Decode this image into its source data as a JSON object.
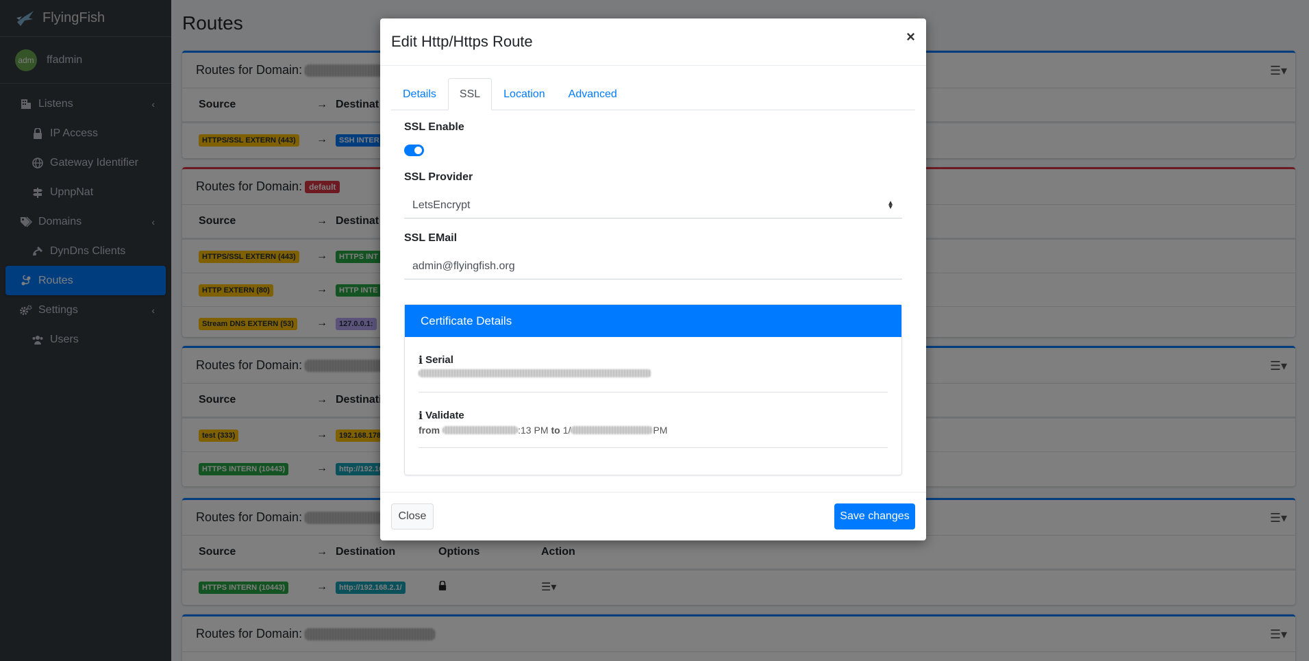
{
  "brand": {
    "name": "FlyingFish"
  },
  "user": {
    "avatar_text": "adm",
    "name": "ffadmin"
  },
  "sidebar": {
    "items": [
      {
        "label": "Listens",
        "icon": "building-icon",
        "has_children": true
      },
      {
        "label": "IP Access",
        "icon": "lock-icon",
        "sub": true
      },
      {
        "label": "Gateway Identifier",
        "icon": "globe-icon",
        "sub": true
      },
      {
        "label": "UpnpNat",
        "icon": "signpost-icon",
        "sub": true
      },
      {
        "label": "Domains",
        "icon": "tags-icon",
        "has_children": true
      },
      {
        "label": "DynDns Clients",
        "icon": "satellite-icon",
        "sub": true
      },
      {
        "label": "Routes",
        "icon": "route-icon",
        "active": true
      },
      {
        "label": "Settings",
        "icon": "cogs-icon",
        "has_children": true
      },
      {
        "label": "Users",
        "icon": "users-icon",
        "sub": true
      }
    ]
  },
  "page": {
    "title": "Routes"
  },
  "cards": {
    "header_prefix": "Routes for Domain:",
    "default_badge": "default",
    "col_source": "Source",
    "col_arrow": "→",
    "col_destination": "Destination",
    "col_destination_short": "Destinat",
    "col_options": "Options",
    "col_action": "Action",
    "card1": {
      "row1_src": "HTTPS/SSL EXTERN (443)",
      "row1_dst": "SSH INTER"
    },
    "card2": {
      "row1_src": "HTTPS/SSL EXTERN (443)",
      "row1_dst": "HTTPS INT",
      "row2_src": "HTTP EXTERN (80)",
      "row2_dst": "HTTP INTE",
      "row3_src": "Stream DNS EXTERN (53)",
      "row3_dst": "127.0.0.1:"
    },
    "card3": {
      "row1_src": "test (333)",
      "row1_dst": "192.168.178.",
      "row2_src": "HTTPS INTERN (10443)",
      "row2_dst": "http://192.16"
    },
    "card4": {
      "row1_src": "HTTPS INTERN (10443)",
      "row1_dst": "http://192.168.2.1/"
    }
  },
  "modal": {
    "title": "Edit Http/Https Route",
    "close_symbol": "×",
    "tabs": [
      "Details",
      "SSL",
      "Location",
      "Advanced"
    ],
    "active_tab": "SSL",
    "ssl_enable_label": "SSL Enable",
    "ssl_enable_value": true,
    "ssl_provider_label": "SSL Provider",
    "ssl_provider_value": "LetsEncrypt",
    "ssl_email_label": "SSL EMail",
    "ssl_email_value": "admin@flyingfish.org",
    "cert_title": "Certificate Details",
    "serial_label": "Serial",
    "validate_label": "Validate",
    "validate_from_word": "from",
    "validate_from_tail": ":13 PM",
    "validate_to_word": "to",
    "validate_to_head": "1/",
    "validate_to_tail": "PM",
    "close_button": "Close",
    "save_button": "Save changes"
  },
  "colors": {
    "primary": "#007bff",
    "sidebar": "#343a40",
    "danger": "#dc3545",
    "warning": "#ffc107",
    "success": "#28a745",
    "info": "#17a2b8"
  }
}
